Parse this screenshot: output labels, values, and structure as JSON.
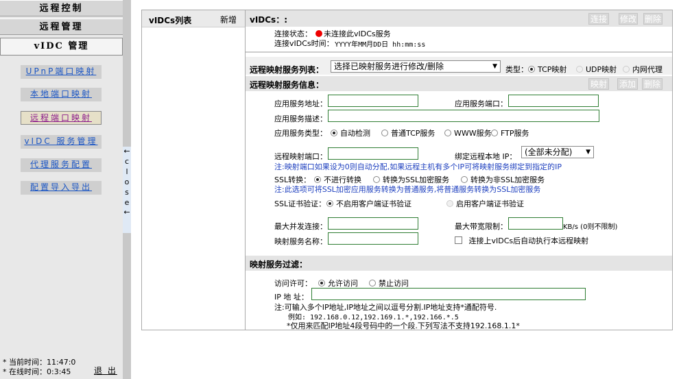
{
  "left_panel": {
    "menu": [
      "远程控制",
      "远程管理",
      "vIDC 管理"
    ],
    "sub_links": [
      "UPnP端口映射",
      "本地端口映射",
      "远程端口映射",
      "vIDC 服务管理",
      "代理服务配置",
      "配置导入导出"
    ],
    "status": {
      "time_label": "* 当前时间：",
      "time_value": "11:47:0",
      "online_label": "* 在线时间：",
      "online_value": "0:3:45",
      "logout": "退 出"
    },
    "close_tab": "close"
  },
  "list_panel": {
    "title": "vIDCs列表",
    "new": "新增"
  },
  "detail": {
    "vidcs_label": "vIDCs：:",
    "buttons": {
      "connect": "连接",
      "modify": "修改",
      "delete": "删除"
    },
    "conn_status_label": "连接状态：",
    "conn_status_value": "未连接此vIDCs服务",
    "conn_time_label": "连接vIDCs时间：",
    "conn_time_value": "YYYY年MM月DD日 hh:mm:ss",
    "service_list_label": "远程映射服务列表：",
    "service_select": "选择已映射服务进行修改/删除",
    "type_label": "类型：",
    "type_options": [
      "TCP映射",
      "UDP映射",
      "内网代理"
    ],
    "info_label": "远程映射服务信息：",
    "info_buttons": {
      "map": "映射",
      "add": "添加",
      "delete": "删除"
    },
    "app_addr_label": "应用服务地址：",
    "app_port_label": "应用服务端口：",
    "app_desc_label": "应用服务描述：",
    "app_type_label": "应用服务类型：",
    "app_type_options": [
      "自动检测",
      "普通TCP服务",
      "WWW服务",
      "FTP服务"
    ],
    "remote_port_label": "远程映射端口：",
    "bind_ip_label": "绑定远程本地 IP：",
    "bind_ip_value": "(全部未分配)",
    "note_port": "注:映射端口如果设为0则自动分配,如果远程主机有多个IP可将映射服务绑定到指定的IP",
    "ssl_label": "SSL转换：",
    "ssl_options": [
      "不进行转换",
      "转换为SSL加密服务",
      "转换为非SSL加密服务"
    ],
    "note_ssl": "注:此选项可将SSL加密应用服务转换为普通服务,将普通服务转换为SSL加密服务",
    "cert_label": "SSL证书验证：",
    "cert_options": [
      "不启用客户端证书验证",
      "启用客户端证书验证"
    ],
    "max_conn_label": "最大并发连接：",
    "max_bw_label": "最大带宽限制：",
    "bw_unit": "KB/s (0则不限制)",
    "svc_name_label": "映射服务名称：",
    "auto_map_label": "连接上vIDCs后自动执行本远程映射",
    "filter_label": "映射服务过滤：",
    "access_label": "访问许可：",
    "access_options": [
      "允许访问",
      "禁止访问"
    ],
    "ip_label": "IP 地 址：",
    "filter_note1": "注:可输入多个IP地址,IP地址之间以逗号分割.IP地址支持*通配符号.",
    "filter_note2": "例如: 192.168.0.12,192.169.1.*,192.166.*.5",
    "filter_note3": "*仅用来匹配IP地址4段号码中的一个段.下列写法不支持192.168.1.1*"
  }
}
